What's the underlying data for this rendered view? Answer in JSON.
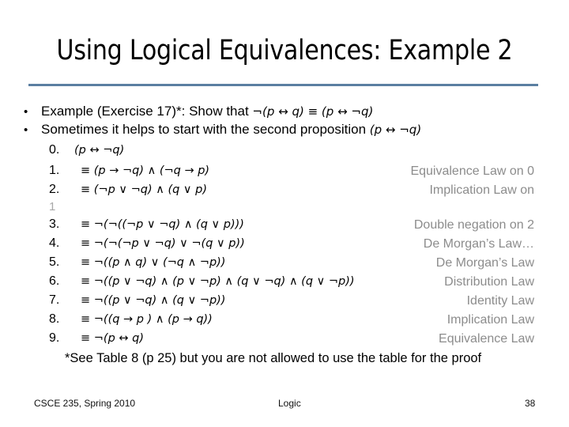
{
  "slide": {
    "title": "Using Logical Equivalences: Example 2",
    "accent_color": "#5b7fa1",
    "bullets": [
      {
        "bullet_glyph": "•",
        "text": "Example (Exercise 17)*: Show that ",
        "math": "¬(p ↔ q) ≡ (p ↔ ¬q)"
      },
      {
        "bullet_glyph": "•",
        "text": "Sometimes it helps to start with the second proposition ",
        "math": "(p ↔ ¬q)"
      }
    ],
    "steps": [
      {
        "num": "0.",
        "expr": "(p ↔ ¬q)",
        "reason": ""
      },
      {
        "num": "1.",
        "expr": "≡ (p → ¬q) ∧ (¬q → p)",
        "reason": "Equivalence Law on 0"
      },
      {
        "num": "2.",
        "expr": "≡ (¬p ∨ ¬q) ∧ (q ∨ p)",
        "reason": "Implication Law on"
      },
      {
        "num": "3.",
        "expr": "≡ ¬(¬((¬p ∨ ¬q) ∧ (q ∨ p)))",
        "reason": "Double negation on 2"
      },
      {
        "num": "4.",
        "expr": "≡ ¬(¬(¬p ∨ ¬q) ∨ ¬(q ∨ p))",
        "reason": "De Morgan’s Law…"
      },
      {
        "num": "5.",
        "expr": "≡ ¬((p ∧ q) ∨ (¬q ∧ ¬p))",
        "reason": "De Morgan’s Law"
      },
      {
        "num": "6.",
        "expr": "≡ ¬((p ∨ ¬q) ∧ (p ∨ ¬p) ∧ (q ∨ ¬q) ∧  (q ∨ ¬p))",
        "reason": "Distribution Law"
      },
      {
        "num": "7.",
        "expr": "≡ ¬((p ∨ ¬q) ∧  (q ∨ ¬p))",
        "reason": "Identity Law"
      },
      {
        "num": "8.",
        "expr": "≡ ¬((q → p ) ∧  (p → q))",
        "reason": "Implication Law"
      },
      {
        "num": "9.",
        "expr": "≡ ¬(p ↔ q)",
        "reason": "Equivalence Law"
      }
    ],
    "wrapped_reason_fragment": "1",
    "footnote": "*See Table 8 (p 25) but you are not allowed to use the table for the proof"
  },
  "footer": {
    "left": "CSCE 235, Spring 2010",
    "center": "Logic",
    "page_number": "38"
  }
}
